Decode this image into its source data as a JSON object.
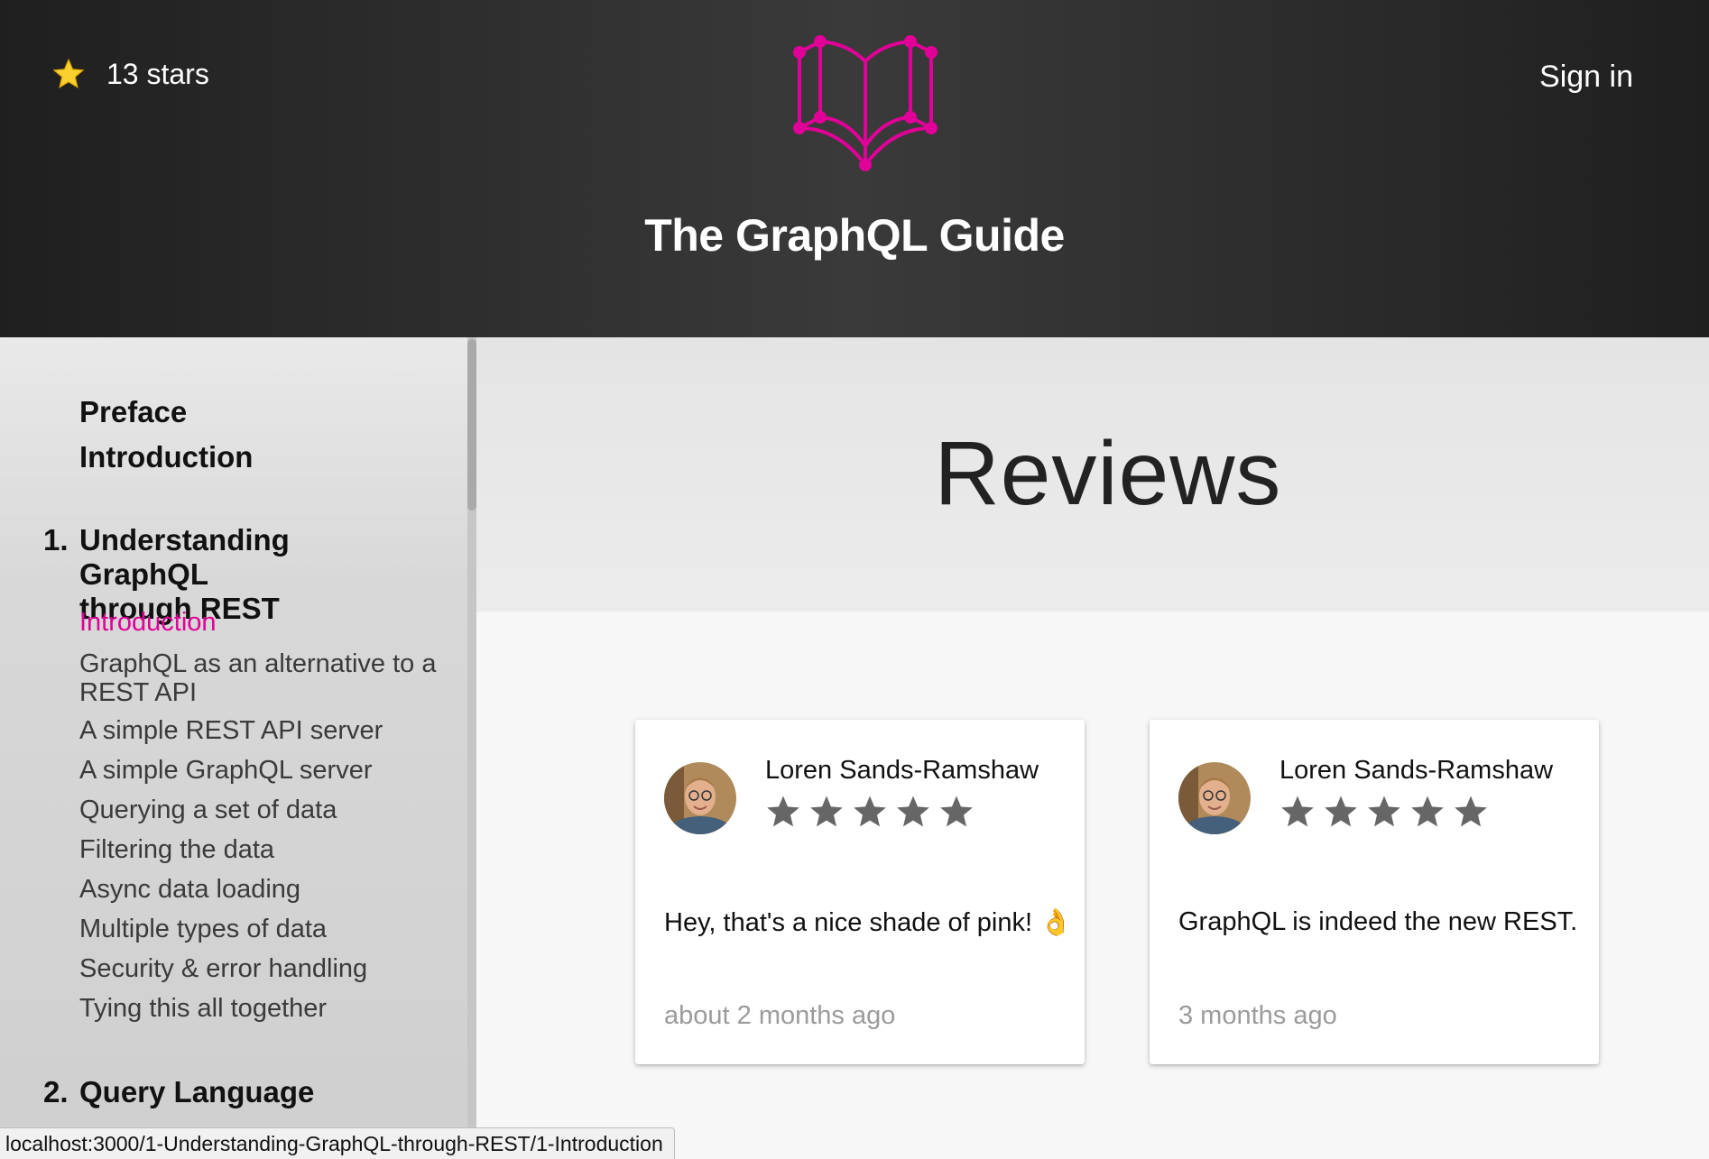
{
  "header": {
    "stars_label": "13 stars",
    "title": "The GraphQL Guide",
    "sign_in": "Sign in",
    "accent_color": "#e10098"
  },
  "sidebar": {
    "top_items": [
      "Preface",
      "Introduction"
    ],
    "chapter1": {
      "number": "1.",
      "title_line1": "Understanding GraphQL",
      "title_line2": "through REST",
      "sections": [
        "Introduction",
        "GraphQL as an alternative to a",
        "REST API",
        "A simple REST API server",
        "A simple GraphQL server",
        "Querying a set of data",
        "Filtering the data",
        "Async data loading",
        "Multiple types of data",
        "Security & error handling",
        "Tying this all together"
      ],
      "active_section": "Introduction"
    },
    "chapter2": {
      "number": "2.",
      "title": "Query Language"
    }
  },
  "main": {
    "title": "Reviews",
    "reviews": [
      {
        "author": "Loren Sands-Ramshaw",
        "stars": 5,
        "text": "Hey, that's a nice shade of pink! 👌",
        "time": "about 2 months ago"
      },
      {
        "author": "Loren Sands-Ramshaw",
        "stars": 5,
        "text": "GraphQL is indeed the new REST.",
        "time": "3 months ago"
      }
    ]
  },
  "statusbar": {
    "url": "localhost:3000/1-Understanding-GraphQL-through-REST/1-Introduction"
  }
}
